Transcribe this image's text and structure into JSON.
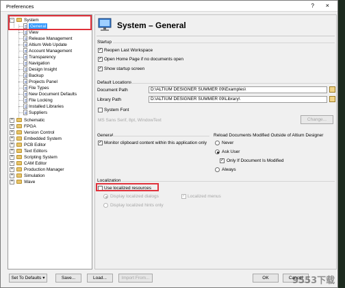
{
  "window": {
    "title": "Preferences",
    "help": "?",
    "close": "×"
  },
  "tree": {
    "system": "System",
    "system_children": [
      "General",
      "View",
      "Release Management",
      "Altium Web Update",
      "Account Management",
      "Transparency",
      "Navigation",
      "Design Insight",
      "Backup",
      "Projects Panel",
      "File Types",
      "New Document Defaults",
      "File Locking",
      "Installed Libraries",
      "Suppliers"
    ],
    "others": [
      "Schematic",
      "FPGA",
      "Version Control",
      "Embedded System",
      "PCB Editor",
      "Text Editors",
      "Scripting System",
      "CAM Editor",
      "Production Manager",
      "Simulation",
      "Wave"
    ]
  },
  "panel": {
    "title": "System – General",
    "startup": {
      "label": "Startup",
      "reopen": "Reopen Last Workspace",
      "open_home": "Open Home Page if no documents open",
      "show_splash": "Show startup screen"
    },
    "default_locations": {
      "label": "Default Locations",
      "doc_path_label": "Document Path",
      "doc_path": "D:\\ALTIUM DESIGNER SUMMER 09\\Examples\\",
      "lib_path_label": "Library Path",
      "lib_path": "D:\\ALTIUM DESIGNER SUMMER 09\\Library\\"
    },
    "system_font": {
      "label": "System Font",
      "value": "MS Sans Serif, 8pt, WindowText",
      "change": "Change..."
    },
    "general": {
      "label": "General",
      "monitor": "Monitor clipboard content within this application only"
    },
    "reload": {
      "label": "Reload Documents Modified Outside of Altium Designer",
      "never": "Never",
      "ask_user": "Ask User",
      "only_if_modified": "Only If Document Is Modified",
      "always": "Always"
    },
    "localization": {
      "label": "Localization",
      "use_localized": "Use localized resources",
      "display_dialogs": "Display localized dialogs",
      "localized_menus": "Localized menus",
      "display_hints": "Display localized hints only"
    }
  },
  "buttons": {
    "set_defaults": "Set To Defaults",
    "set_defaults_arrow": "▾",
    "save": "Save...",
    "load": "Load...",
    "import_from": "Import From...",
    "ok": "OK",
    "cancel": "Cancel"
  },
  "watermark": "9553下载"
}
